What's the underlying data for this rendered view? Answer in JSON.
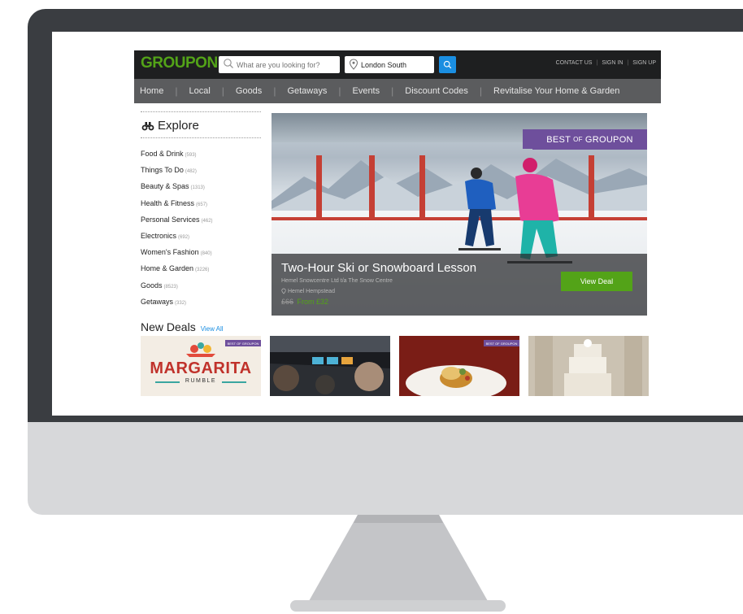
{
  "header": {
    "logo": "GROUPON",
    "search_placeholder": "What are you looking for?",
    "location_value": "London South",
    "links": [
      "CONTACT US",
      "SIGN IN",
      "SIGN UP"
    ]
  },
  "nav": {
    "items": [
      "Home",
      "Local",
      "Goods",
      "Getaways",
      "Events",
      "Discount Codes",
      "Revitalise Your Home & Garden"
    ]
  },
  "sidebar": {
    "title": "Explore",
    "categories": [
      {
        "label": "Food & Drink",
        "count": "(593)"
      },
      {
        "label": "Things To Do",
        "count": "(482)"
      },
      {
        "label": "Beauty & Spas",
        "count": "(1313)"
      },
      {
        "label": "Health & Fitness",
        "count": "(657)"
      },
      {
        "label": "Personal Services",
        "count": "(462)"
      },
      {
        "label": "Electronics",
        "count": "(692)"
      },
      {
        "label": "Women's Fashion",
        "count": "(840)"
      },
      {
        "label": "Home & Garden",
        "count": "(3226)"
      },
      {
        "label": "Goods",
        "count": "(8523)"
      },
      {
        "label": "Getaways",
        "count": "(332)"
      }
    ]
  },
  "hero": {
    "badge_prefix": "BEST",
    "badge_of": "OF",
    "badge_suffix": "GROUPON",
    "title": "Two-Hour Ski or Snowboard Lesson",
    "merchant": "Hemel Snowcentre Ltd t/a The Snow Centre",
    "location": "Hemel Hempstead",
    "old_price": "£66",
    "new_price": "From £32",
    "button_label": "View Deal"
  },
  "new_deals": {
    "title": "New Deals",
    "view_all": "View All",
    "tile_badge": "BEST OF GROUPON",
    "tile1_title": "MARGARITA",
    "tile1_subtitle": "RUMBLE"
  },
  "colors": {
    "brand_green": "#53a318",
    "accent_blue": "#1a8ee1",
    "badge_purple": "#6e4f9c",
    "header_dark": "#1e1f20",
    "nav_grey": "#5b5c5e"
  },
  "icons": [
    "binoculars-icon",
    "search-icon",
    "location-pin-icon"
  ]
}
